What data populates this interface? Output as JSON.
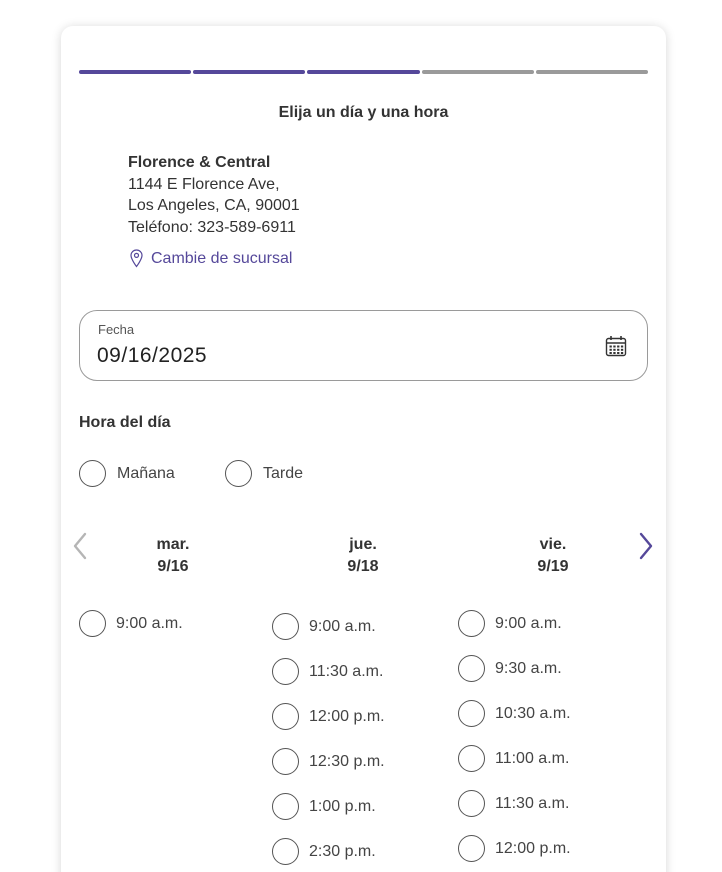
{
  "progress": {
    "total_steps": 5,
    "completed_steps": 3,
    "active_color": "#55489a",
    "inactive_color": "#9a9a9a"
  },
  "title": "Elija un día y una hora",
  "branch": {
    "name": "Florence & Central",
    "address_line1": "1144 E Florence Ave,",
    "address_line2": "Los Angeles, CA, 90001",
    "phone": "Teléfono: 323-589-6911",
    "change_label": "Cambie de sucursal"
  },
  "date_field": {
    "label": "Fecha",
    "value": "09/16/2025",
    "icon": "calendar-icon"
  },
  "time_of_day": {
    "label": "Hora del día",
    "options": [
      "Mañana",
      "Tarde"
    ]
  },
  "nav": {
    "prev_icon": "chevron-left-icon",
    "next_icon": "chevron-right-icon"
  },
  "days": [
    {
      "weekday": "mar.",
      "date": "9/16",
      "slots": [
        "9:00 a.m."
      ]
    },
    {
      "weekday": "jue.",
      "date": "9/18",
      "slots": [
        "9:00 a.m.",
        "11:30 a.m.",
        "12:00 p.m.",
        "12:30 p.m.",
        "1:00 p.m.",
        "2:30 p.m."
      ]
    },
    {
      "weekday": "vie.",
      "date": "9/19",
      "slots": [
        "9:00 a.m.",
        "9:30 a.m.",
        "10:30 a.m.",
        "11:00 a.m.",
        "11:30 a.m.",
        "12:00 p.m."
      ]
    }
  ]
}
